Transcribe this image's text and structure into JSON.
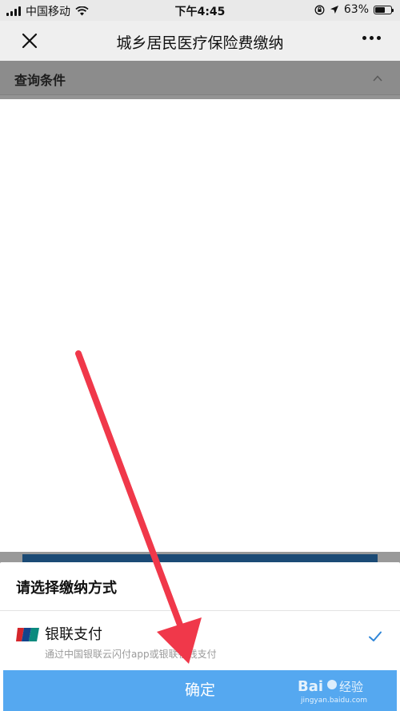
{
  "status_bar": {
    "carrier": "中国移动",
    "time": "下午4:45",
    "battery": "63%",
    "battery_level": 0.63
  },
  "nav": {
    "title": "城乡居民医疗保险费缴纳"
  },
  "query": {
    "label": "查询条件"
  },
  "payment_sheet": {
    "title": "请选择缴纳方式",
    "option": {
      "name": "银联支付",
      "description": "通过中国银联云闪付app或银联在线支付",
      "selected": true
    },
    "confirm_label": "确定"
  },
  "watermark": {
    "brand": "Bai 经验",
    "url": "jingyan.baidu.com"
  },
  "colors": {
    "accent": "#55a8f0",
    "check": "#2f86d8",
    "annotation": "#f0384a"
  }
}
